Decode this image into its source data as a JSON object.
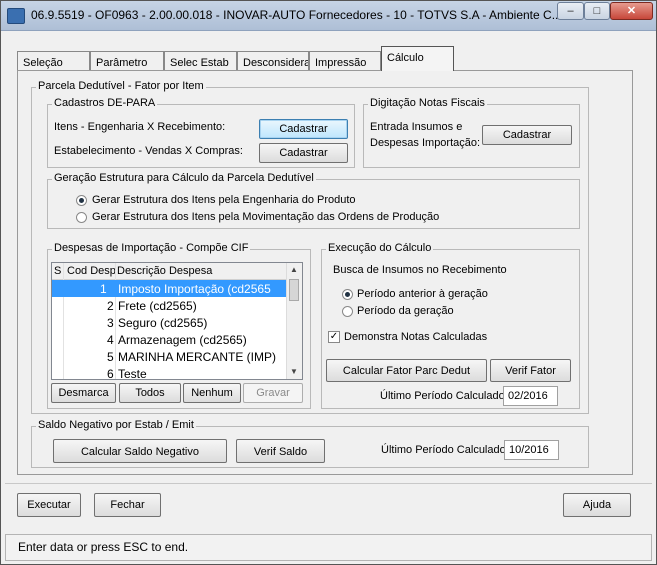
{
  "window": {
    "title": "06.9.5519 - OF0963 - 2.00.00.018 - INOVAR-AUTO Fornecedores - 10 - TOTVS S.A - Ambiente C...",
    "minimize": "‒",
    "maximize": "□",
    "close": "✕"
  },
  "tabs": [
    "Seleção",
    "Parâmetro",
    "Selec Estab",
    "Desconsidera",
    "Impressão",
    "Cálculo"
  ],
  "active_tab": "Cálculo",
  "parcela": {
    "legend": "Parcela Dedutível - Fator por Item",
    "cadastros": {
      "legend": "Cadastros DE-PARA",
      "itens_label": "Itens - Engenharia X Recebimento:",
      "itens_button": "Cadastrar",
      "estab_label": "Estabelecimento - Vendas X Compras:",
      "estab_button": "Cadastrar"
    },
    "digitacao": {
      "legend": "Digitação Notas Fiscais",
      "line1": "Entrada Insumos e",
      "line2": "Despesas Importação:",
      "button": "Cadastrar"
    },
    "geracao": {
      "legend": "Geração Estrutura para Cálculo da Parcela Dedutível",
      "option1": "Gerar Estrutura dos Itens pela Engenharia do Produto",
      "option2": "Gerar Estrutura dos Itens pela Movimentação das Ordens de Produção",
      "selected": 1
    },
    "despesas": {
      "legend": "Despesas de Importação - Compõe CIF",
      "columns": [
        "S",
        "Cod Desp",
        "Descrição Despesa"
      ],
      "rows": [
        {
          "cod": "1",
          "desc": "Imposto Importação (cd2565"
        },
        {
          "cod": "2",
          "desc": "Frete (cd2565)"
        },
        {
          "cod": "3",
          "desc": "Seguro (cd2565)"
        },
        {
          "cod": "4",
          "desc": "Armazenagem (cd2565)"
        },
        {
          "cod": "5",
          "desc": "MARINHA MERCANTE (IMP)"
        },
        {
          "cod": "6",
          "desc": "Teste"
        }
      ],
      "selected_row": 0,
      "btn_desmarca": "Desmarca",
      "btn_todos": "Todos",
      "btn_nenhum": "Nenhum",
      "btn_gravar": "Gravar"
    },
    "execucao": {
      "legend": "Execução do Cálculo",
      "busca_label": "Busca de Insumos no Recebimento",
      "option1": "Período anterior à geração",
      "option2": "Período da geração",
      "selected": 1,
      "demonstra_label": "Demonstra Notas Calculadas",
      "demonstra_checked": true,
      "btn_calcular": "Calcular Fator Parc Dedut",
      "btn_verif": "Verif Fator",
      "ultimo_label": "Último Período Calculado:",
      "ultimo_value": "02/2016"
    }
  },
  "saldo": {
    "legend": "Saldo Negativo por Estab / Emit",
    "btn_calcular": "Calcular Saldo Negativo",
    "btn_verif": "Verif Saldo",
    "ultimo_label": "Último Período Calculado:",
    "ultimo_value": "10/2016"
  },
  "footer": {
    "executar": "Executar",
    "fechar": "Fechar",
    "ajuda": "Ajuda"
  },
  "status": "Enter data or press ESC to end."
}
